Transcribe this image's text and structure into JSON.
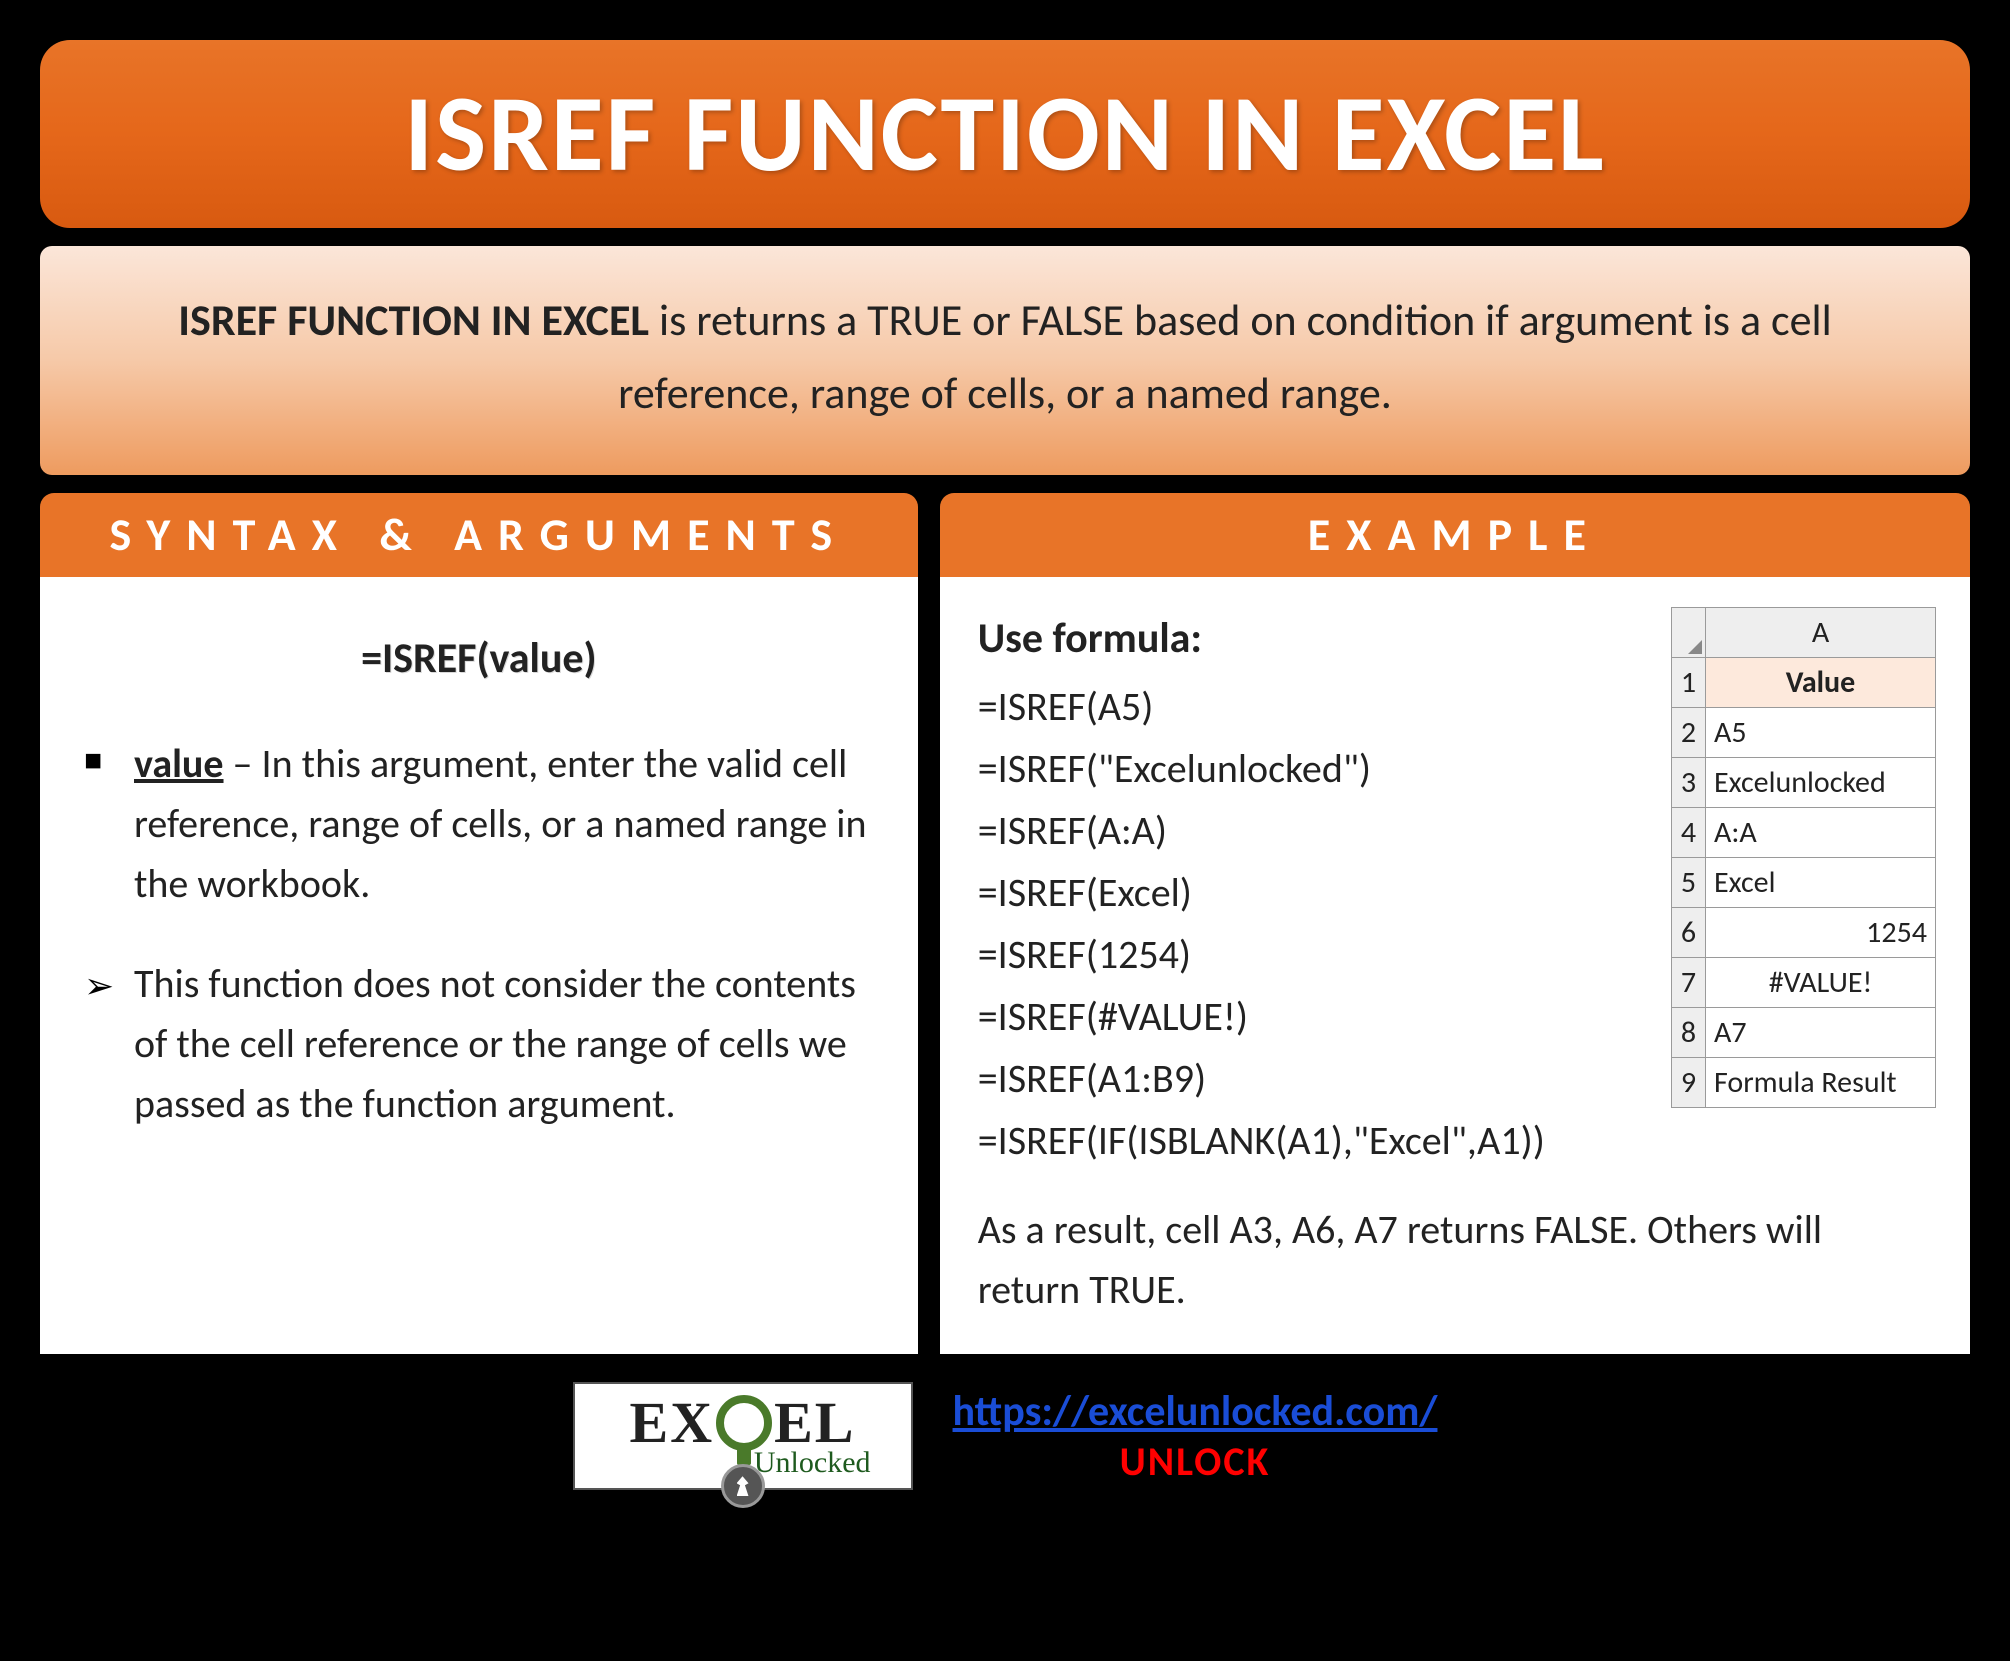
{
  "title": "ISREF FUNCTION IN EXCEL",
  "description": {
    "bold_lead": "ISREF FUNCTION IN EXCEL",
    "rest": " is returns a TRUE or FALSE based on condition if argument is a cell reference, range of cells, or a named range."
  },
  "syntax": {
    "header": "SYNTAX & ARGUMENTS",
    "formula": "=ISREF(value)",
    "value_label": "value",
    "value_sep": " – ",
    "value_desc": "In this argument, enter the valid cell reference, range of cells, or a named range in the workbook.",
    "note": "This function does not consider the contents of the cell reference or the range of cells we passed as the function argument."
  },
  "example": {
    "header": "EXAMPLE",
    "use_formula_label": "Use formula:",
    "formulas": [
      "=ISREF(A5)",
      "=ISREF(\"Excelunlocked\")",
      "=ISREF(A:A)",
      "=ISREF(Excel)",
      "=ISREF(1254)",
      "=ISREF(#VALUE!)",
      "=ISREF(A1:B9)",
      "=ISREF(IF(ISBLANK(A1),\"Excel\",A1))"
    ],
    "result_text": "As a result, cell A3, A6, A7 returns FALSE. Others will return TRUE.",
    "table": {
      "col_header": "A",
      "rows": [
        {
          "n": "1",
          "v": "Value",
          "cls": "header-cell"
        },
        {
          "n": "2",
          "v": "A5",
          "cls": "cell-left"
        },
        {
          "n": "3",
          "v": "Excelunlocked",
          "cls": "cell-left"
        },
        {
          "n": "4",
          "v": "A:A",
          "cls": "cell-left"
        },
        {
          "n": "5",
          "v": "Excel",
          "cls": "cell-left"
        },
        {
          "n": "6",
          "v": "1254",
          "cls": "cell-right"
        },
        {
          "n": "7",
          "v": "#VALUE!",
          "cls": "cell-center"
        },
        {
          "n": "8",
          "v": "A7",
          "cls": "cell-left"
        },
        {
          "n": "9",
          "v": "Formula Result",
          "cls": "cell-left"
        }
      ]
    }
  },
  "footer": {
    "logo_main_pre": "EX",
    "logo_main_mid": "EL",
    "logo_sub": "Unlocked",
    "link_text": "https://excelunlocked.com/",
    "unlock": "UNLOCK"
  }
}
